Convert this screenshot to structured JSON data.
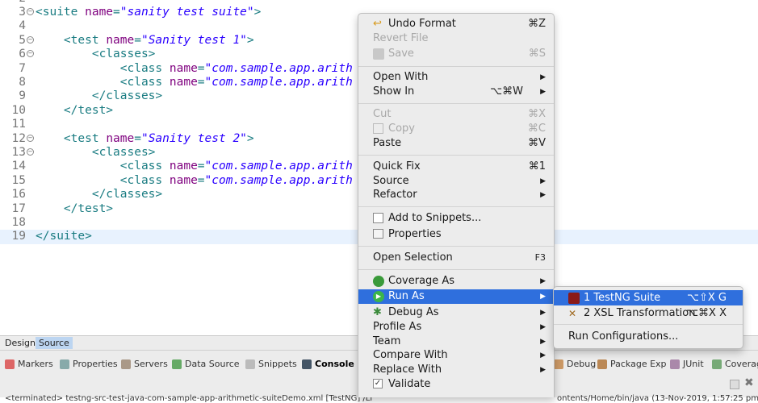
{
  "editor": {
    "lines": [
      {
        "num": "2",
        "parts": []
      },
      {
        "num": "3",
        "fold": true,
        "parts": [
          {
            "c": "tag",
            "t": "<suite "
          },
          {
            "c": "attr",
            "t": "name"
          },
          {
            "c": "tag",
            "t": "="
          },
          {
            "c": "val",
            "t": "\"sanity test suite\""
          },
          {
            "c": "tag",
            "t": ">"
          }
        ]
      },
      {
        "num": "4",
        "parts": []
      },
      {
        "num": "5",
        "fold": true,
        "parts": [
          {
            "c": "tag",
            "t": "    <test "
          },
          {
            "c": "attr",
            "t": "name"
          },
          {
            "c": "tag",
            "t": "="
          },
          {
            "c": "val",
            "t": "\"Sanity test 1\""
          },
          {
            "c": "tag",
            "t": ">"
          }
        ]
      },
      {
        "num": "6",
        "fold": true,
        "parts": [
          {
            "c": "tag",
            "t": "        <classes>"
          }
        ]
      },
      {
        "num": "7",
        "parts": [
          {
            "c": "tag",
            "t": "            <class "
          },
          {
            "c": "attr",
            "t": "name"
          },
          {
            "c": "tag",
            "t": "="
          },
          {
            "c": "val",
            "t": "\"com.sample.app.arith"
          }
        ]
      },
      {
        "num": "8",
        "parts": [
          {
            "c": "tag",
            "t": "            <class "
          },
          {
            "c": "attr",
            "t": "name"
          },
          {
            "c": "tag",
            "t": "="
          },
          {
            "c": "val",
            "t": "\"com.sample.app.arith"
          }
        ]
      },
      {
        "num": "9",
        "parts": [
          {
            "c": "tag",
            "t": "        </classes>"
          }
        ]
      },
      {
        "num": "10",
        "parts": [
          {
            "c": "tag",
            "t": "    </test>"
          }
        ]
      },
      {
        "num": "11",
        "parts": []
      },
      {
        "num": "12",
        "fold": true,
        "parts": [
          {
            "c": "tag",
            "t": "    <test "
          },
          {
            "c": "attr",
            "t": "name"
          },
          {
            "c": "tag",
            "t": "="
          },
          {
            "c": "val",
            "t": "\"Sanity test 2\""
          },
          {
            "c": "tag",
            "t": ">"
          }
        ]
      },
      {
        "num": "13",
        "fold": true,
        "parts": [
          {
            "c": "tag",
            "t": "        <classes>"
          }
        ]
      },
      {
        "num": "14",
        "parts": [
          {
            "c": "tag",
            "t": "            <class "
          },
          {
            "c": "attr",
            "t": "name"
          },
          {
            "c": "tag",
            "t": "="
          },
          {
            "c": "val",
            "t": "\"com.sample.app.arith"
          }
        ]
      },
      {
        "num": "15",
        "parts": [
          {
            "c": "tag",
            "t": "            <class "
          },
          {
            "c": "attr",
            "t": "name"
          },
          {
            "c": "tag",
            "t": "="
          },
          {
            "c": "val",
            "t": "\"com.sample.app.arith"
          }
        ]
      },
      {
        "num": "16",
        "parts": [
          {
            "c": "tag",
            "t": "        </classes>"
          }
        ]
      },
      {
        "num": "17",
        "parts": [
          {
            "c": "tag",
            "t": "    </test>"
          }
        ]
      },
      {
        "num": "18",
        "parts": []
      },
      {
        "num": "19",
        "current": true,
        "parts": [
          {
            "c": "tag",
            "t": "</suite>"
          }
        ]
      }
    ],
    "tabs": {
      "design": "Design",
      "source": "Source"
    }
  },
  "views": {
    "tabs": [
      "Markers",
      "Properties",
      "Servers",
      "Data Source",
      "Snippets",
      "Console",
      "Debug",
      "Package Exp",
      "JUnit",
      "Coverage"
    ],
    "console_text": "<terminated> testng-src-test-java-com-sample-app-arithmetic-suiteDemo.xml [TestNG] /Li",
    "console_text_right": "ontents/Home/bin/java (13-Nov-2019, 1:57:25 pm)"
  },
  "context_menu": {
    "undo_format": "Undo Format",
    "undo_sc": "⌘Z",
    "revert_file": "Revert File",
    "save": "Save",
    "save_sc": "⌘S",
    "open_with": "Open With",
    "show_in": "Show In",
    "show_in_sc": "⌥⌘W",
    "cut": "Cut",
    "cut_sc": "⌘X",
    "copy": "Copy",
    "copy_sc": "⌘C",
    "paste": "Paste",
    "paste_sc": "⌘V",
    "quick_fix": "Quick Fix",
    "quick_fix_sc": "⌘1",
    "source": "Source",
    "refactor": "Refactor",
    "add_snippets": "Add to Snippets...",
    "properties": "Properties",
    "open_selection": "Open Selection",
    "open_selection_sc": "F3",
    "coverage_as": "Coverage As",
    "run_as": "Run As",
    "debug_as": "Debug As",
    "profile_as": "Profile As",
    "team": "Team",
    "compare_with": "Compare With",
    "replace_with": "Replace With",
    "validate": "Validate"
  },
  "run_as_submenu": {
    "testng_suite": "1 TestNG Suite",
    "testng_sc": "⌥⇧X G",
    "xsl": "2 XSL Transformation",
    "xsl_sc": "⌥⌘X X",
    "run_configs": "Run Configurations..."
  },
  "colors": {
    "highlight": "#2f6fdd",
    "menu_bg": "#ececec"
  }
}
